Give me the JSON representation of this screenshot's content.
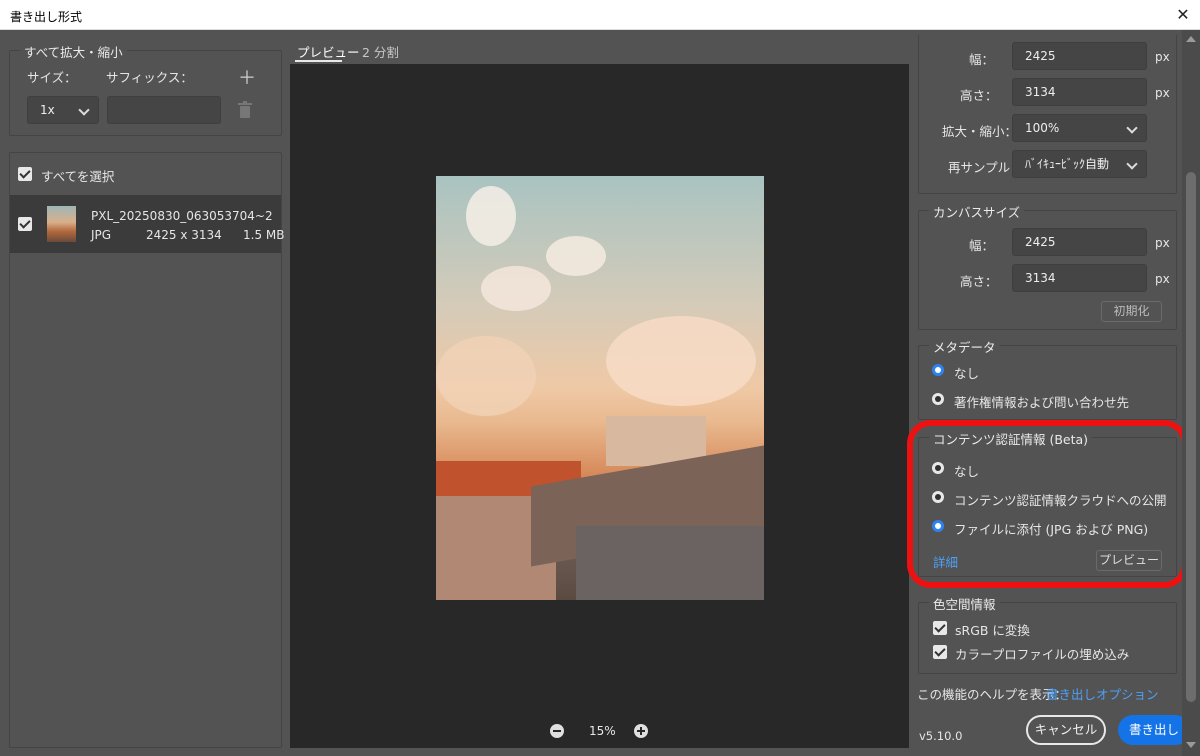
{
  "window": {
    "title": "書き出し形式",
    "close_icon": "close-icon"
  },
  "left": {
    "scale_all": {
      "legend": "すべて拡大・縮小",
      "size_label": "サイズ：",
      "suffix_label": "サフィックス：",
      "size_value": "1x",
      "suffix_value": ""
    },
    "select_all": "すべてを選択",
    "file": {
      "name": "PXL_20250830_063053704~2",
      "type": "JPG",
      "dimensions": "2425 x 3134",
      "size": "1.5 MB"
    }
  },
  "preview": {
    "tabs": [
      "プレビュー",
      "2 分割"
    ],
    "zoom": "15%"
  },
  "right": {
    "image_size": {
      "width_label": "幅：",
      "width": "2425",
      "height_label": "高さ：",
      "height": "3134",
      "scale_label": "拡大・縮小：",
      "scale": "100%",
      "resample_label": "再サンプル：",
      "resample": "ﾊﾞｲｷｭｰﾋﾞｯｸ自動",
      "unit": "px"
    },
    "canvas_size": {
      "legend": "カンバスサイズ",
      "width_label": "幅：",
      "width": "2425",
      "height_label": "高さ：",
      "height": "3134",
      "unit": "px",
      "reset": "初期化"
    },
    "metadata": {
      "legend": "メタデータ",
      "options": [
        "なし",
        "著作権情報および問い合わせ先"
      ]
    },
    "content_credentials": {
      "legend": "コンテンツ認証情報 (Beta)",
      "options": [
        "なし",
        "コンテンツ認証情報クラウドへの公開",
        "ファイルに添付 (JPG および PNG)"
      ],
      "details": "詳細",
      "preview": "プレビュー",
      "highlight_color": "#ee1111"
    },
    "color_space": {
      "legend": "色空間情報",
      "convert": "sRGB に変換",
      "embed": "カラープロファイルの埋め込み"
    },
    "help_text": "この機能のヘルプを表示：",
    "help_link": "書き出しオプション",
    "version": "v5.10.0",
    "cancel": "キャンセル",
    "export": "書き出し"
  }
}
